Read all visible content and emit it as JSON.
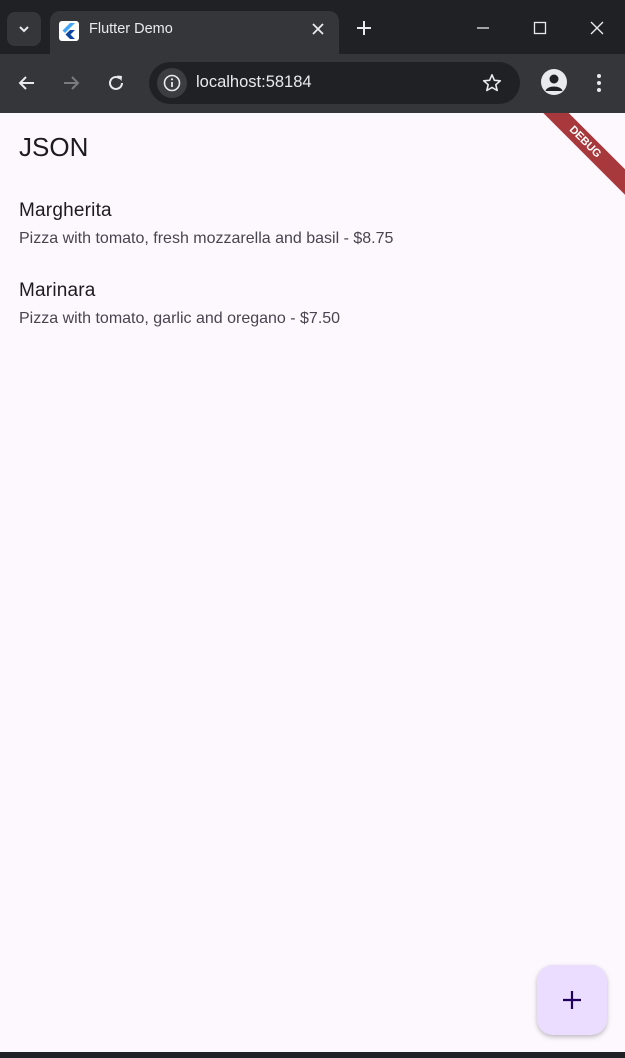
{
  "browser": {
    "tab_title": "Flutter Demo",
    "url": "localhost:58184"
  },
  "app": {
    "title": "JSON",
    "debug_banner": "DEBUG",
    "items": [
      {
        "title": "Margherita",
        "subtitle": "Pizza with tomato, fresh mozzarella and basil - $8.75"
      },
      {
        "title": "Marinara",
        "subtitle": "Pizza with tomato, garlic and oregano - $7.50"
      }
    ]
  },
  "icons": {
    "tab_search": "chevron-down-icon",
    "favicon": "flutter-logo-icon",
    "tab_close": "close-icon",
    "new_tab": "plus-icon",
    "minimize": "minimize-icon",
    "maximize": "maximize-icon",
    "close_window": "close-icon",
    "back": "arrow-left-icon",
    "forward": "arrow-right-icon",
    "reload": "reload-icon",
    "site_info": "info-icon",
    "bookmark": "star-icon",
    "profile": "person-icon",
    "menu": "more-vert-icon",
    "fab": "plus-icon"
  },
  "colors": {
    "page_background": "#fdf7fe",
    "fab_background": "#eaddff",
    "debug_banner": "#a7393c",
    "browser_chrome": "#202124"
  }
}
